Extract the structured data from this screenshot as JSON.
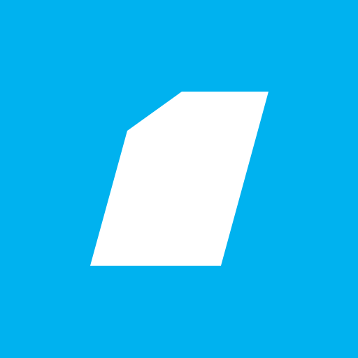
{
  "app_icon": {
    "icon": "slanted-parallelogram-logo-icon",
    "colors": {
      "background": "#00B2EF",
      "shape": "#FFFFFF"
    }
  }
}
